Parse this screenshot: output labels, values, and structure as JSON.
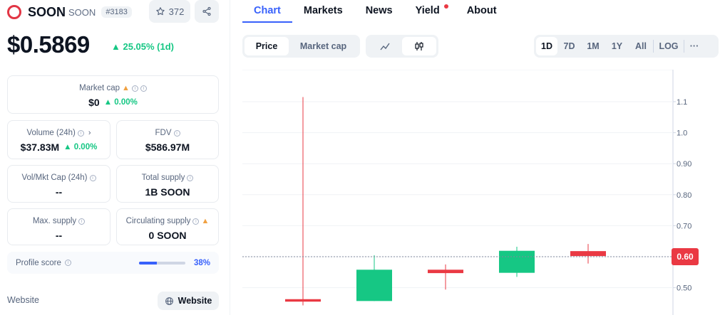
{
  "coin": {
    "name": "SOON",
    "symbol": "SOON",
    "rank": "#3183",
    "watchlist_count": "372",
    "price": "$0.5869",
    "price_change": "▲ 25.05% (1d)"
  },
  "stats": {
    "market_cap": {
      "label": "Market cap",
      "value": "$0",
      "change": "▲ 0.00%"
    },
    "volume": {
      "label": "Volume (24h)",
      "value": "$37.83M",
      "change": "▲ 0.00%"
    },
    "fdv": {
      "label": "FDV",
      "value": "$586.97M"
    },
    "vol_mkt_cap": {
      "label": "Vol/Mkt Cap (24h)",
      "value": "--"
    },
    "total_supply": {
      "label": "Total supply",
      "value": "1B SOON"
    },
    "max_supply": {
      "label": "Max. supply",
      "value": "--"
    },
    "circulating_supply": {
      "label": "Circulating supply",
      "value": "0 SOON"
    }
  },
  "profile": {
    "label": "Profile score",
    "score": "38%",
    "fraction": 0.38
  },
  "website": {
    "label": "Website",
    "button": "Website"
  },
  "tabs": [
    "Chart",
    "Markets",
    "News",
    "Yield",
    "About"
  ],
  "chart_controls": {
    "metric": [
      "Price",
      "Market cap"
    ],
    "selected_metric": "Price",
    "chart_types": [
      "line-chart-icon",
      "candlestick-icon"
    ],
    "selected_type": "candlestick-icon",
    "ranges": [
      "1D",
      "7D",
      "1M",
      "1Y",
      "All",
      "LOG"
    ],
    "selected_range": "1D",
    "more": "···"
  },
  "colors": {
    "up": "#16c784",
    "down": "#ea3943",
    "accent": "#3861fb"
  },
  "chart_data": {
    "type": "candlestick",
    "y_ticks": [
      "1.1",
      "1.0",
      "0.90",
      "0.80",
      "0.70",
      "0.60",
      "0.50"
    ],
    "ylim": [
      0.43,
      1.2
    ],
    "current_price_label": "0.60",
    "current_price": 0.6,
    "candles": [
      {
        "open": 0.463,
        "close": 0.455,
        "high": 1.115,
        "low": 0.443
      },
      {
        "open": 0.457,
        "close": 0.558,
        "high": 0.605,
        "low": 0.457
      },
      {
        "open": 0.558,
        "close": 0.547,
        "high": 0.575,
        "low": 0.494
      },
      {
        "open": 0.548,
        "close": 0.619,
        "high": 0.632,
        "low": 0.535
      },
      {
        "open": 0.618,
        "close": 0.602,
        "high": 0.641,
        "low": 0.578
      }
    ]
  }
}
